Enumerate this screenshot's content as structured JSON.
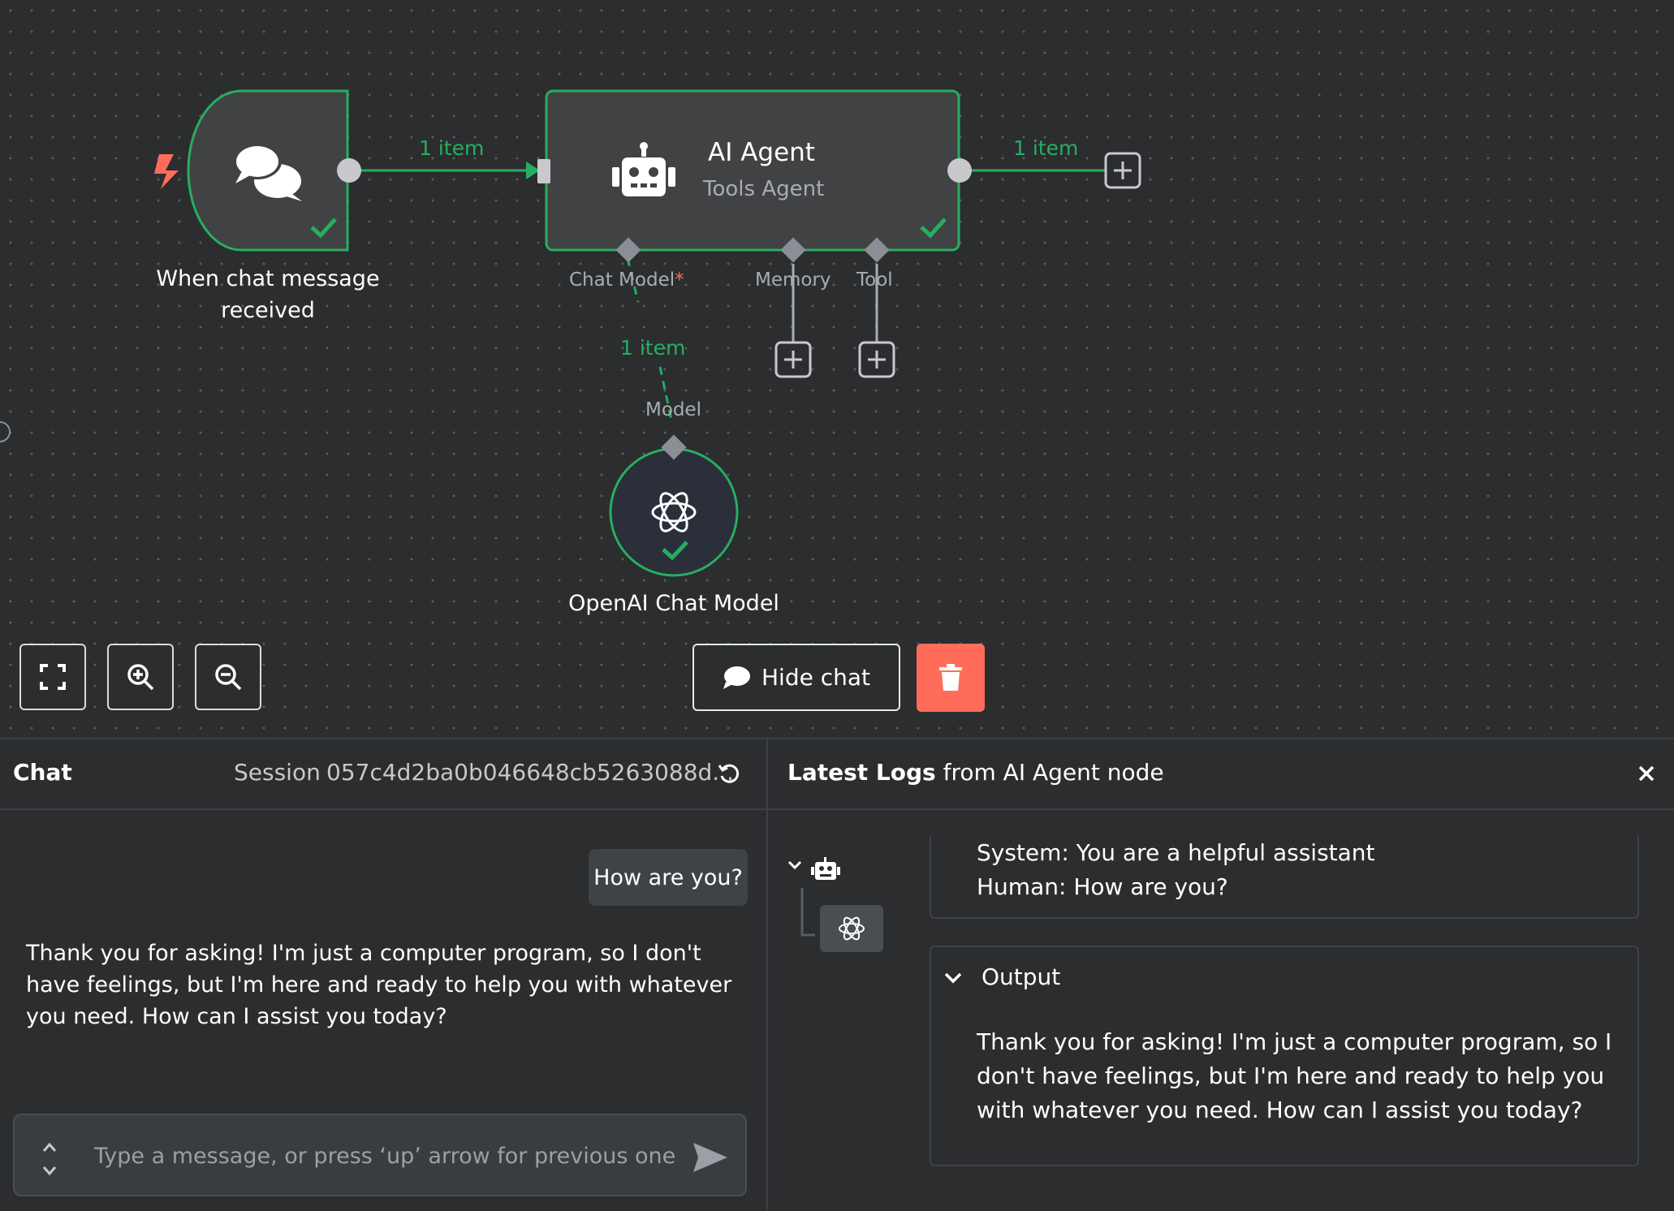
{
  "canvas": {
    "nodes": {
      "trigger": {
        "label_line1": "When chat message",
        "label_line2": "received"
      },
      "agent": {
        "title": "AI Agent",
        "subtitle": "Tools Agent"
      },
      "model": {
        "label": "OpenAI Chat Model"
      }
    },
    "connections": {
      "trigger_to_agent": "1 item",
      "agent_out": "1 item",
      "model_to_agent": "1 item"
    },
    "ports": {
      "chat_model": "Chat Model",
      "chat_model_required": "*",
      "memory": "Memory",
      "tool": "Tool",
      "model": "Model"
    },
    "controls": {
      "hide_chat": "Hide chat"
    }
  },
  "chat": {
    "title": "Chat",
    "session_label": "Session",
    "session_id": "057c4d2ba0b046648cb5263088d...",
    "messages": {
      "user": "How are you?",
      "bot": "Thank you for asking! I'm just a computer program, so I don't have feelings, but I'm here and ready to help you with whatever you need. How can I assist you today?"
    },
    "input_placeholder": "Type a message, or press ‘up’ arrow for previous one"
  },
  "logs": {
    "title_bold": "Latest Logs",
    "title_rest": "from AI Agent node",
    "input_line1": "System: You are a helpful assistant",
    "input_line2": "Human: How are you?",
    "output_label": "Output",
    "output_text": "Thank you for asking! I'm just a computer program, so I don't have feelings, but I'm here and ready to help you with whatever you need. How can I assist you today?"
  },
  "colors": {
    "accent_green": "#27ae60",
    "delete_red": "#ff6d5a",
    "trigger_orange": "#ff6d5a",
    "node_bg": "#414244",
    "canvas_bg": "#2b2d2f"
  }
}
